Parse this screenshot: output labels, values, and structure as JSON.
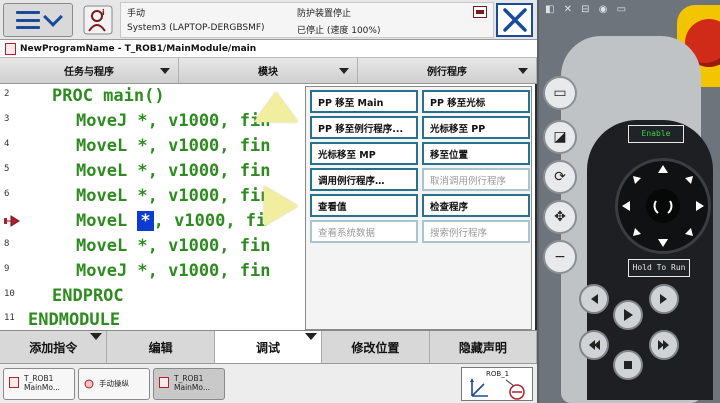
{
  "topbar": {
    "status": {
      "mode": "手动",
      "system": "System3 (LAPTOP-DERGBSMF)",
      "safety": "防护装置停止",
      "state": "已停止 (速度 100%)"
    }
  },
  "breadcrumb": "NewProgramName - T_ROB1/MainModule/main",
  "column_tabs": [
    "任务与程序",
    "模块",
    "例行程序"
  ],
  "code": {
    "lines": [
      {
        "no": "2",
        "text": "PROC main()",
        "indent": 1
      },
      {
        "no": "3",
        "text": "MoveJ *, v1000, fin",
        "indent": 2
      },
      {
        "no": "4",
        "text": "MoveL *, v1000, fin",
        "indent": 2
      },
      {
        "no": "5",
        "text": "MoveL *, v1000, fin",
        "indent": 2
      },
      {
        "no": "6",
        "text": "MoveL *, v1000, fin",
        "indent": 2
      },
      {
        "no": "",
        "pre": "MoveL ",
        "hl": "*",
        "post": ", v1000, fi",
        "indent": 2,
        "pp": true
      },
      {
        "no": "8",
        "text": "MoveL *, v1000, fin",
        "indent": 2
      },
      {
        "no": "9",
        "text": "MoveJ *, v1000, fin",
        "indent": 2
      },
      {
        "no": "10",
        "text": "ENDPROC",
        "indent": 1
      },
      {
        "no": "11",
        "text": "ENDMODULE",
        "indent": 0
      }
    ]
  },
  "popup": {
    "items": [
      {
        "label": "PP 移至 Main",
        "enabled": true
      },
      {
        "label": "PP 移至光标",
        "enabled": true
      },
      {
        "label": "PP 移至例行程序...",
        "enabled": true
      },
      {
        "label": "光标移至 PP",
        "enabled": true
      },
      {
        "label": "光标移至 MP",
        "enabled": true
      },
      {
        "label": "移至位置",
        "enabled": true
      },
      {
        "label": "调用例行程序…",
        "enabled": true
      },
      {
        "label": "取消调用例行程序",
        "enabled": false
      },
      {
        "label": "查看值",
        "enabled": true
      },
      {
        "label": "检查程序",
        "enabled": true
      },
      {
        "label": "查看系统数据",
        "enabled": false
      },
      {
        "label": "搜索例行程序",
        "enabled": false
      }
    ]
  },
  "bottom_tabs": [
    {
      "label": "添加指令",
      "active": false,
      "has_menu": true
    },
    {
      "label": "编辑",
      "active": false,
      "has_menu": false
    },
    {
      "label": "调试",
      "active": true,
      "has_menu": true
    },
    {
      "label": "修改位置",
      "active": false,
      "has_menu": false
    },
    {
      "label": "隐藏声明",
      "active": false,
      "has_menu": false
    }
  ],
  "taskbar": {
    "tasks": [
      {
        "line1": "T_ROB1",
        "line2": "MainMo...",
        "active": false
      },
      {
        "line1": "手动操纵",
        "line2": "",
        "active": false
      },
      {
        "line1": "T_ROB1",
        "line2": "MainMo...",
        "active": true
      }
    ],
    "rob_label": "ROB_1"
  },
  "pendant": {
    "enable_label": "Enable",
    "hold_label": "Hold To Run"
  },
  "colors": {
    "code_green": "#2e8b1f",
    "highlight_blue": "#0b3bd1",
    "frame_blue": "#1a4a9a",
    "button_border": "#27718c",
    "estop_red": "#d02a18",
    "estop_yellow": "#f3c400"
  }
}
